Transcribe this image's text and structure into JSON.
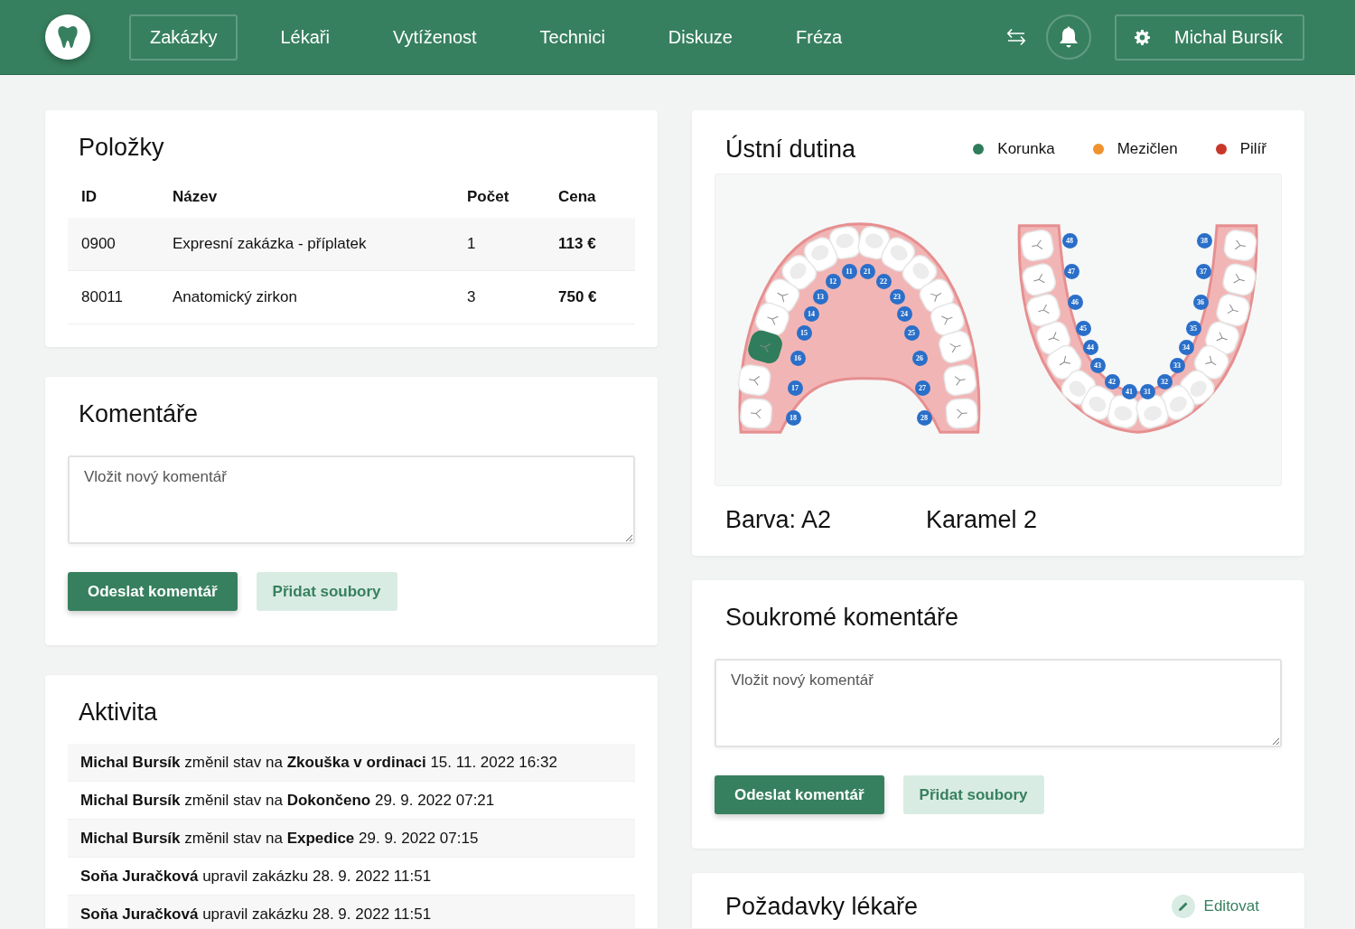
{
  "header": {
    "nav": [
      {
        "label": "Zakázky",
        "selected": true
      },
      {
        "label": "Lékaři",
        "selected": false
      },
      {
        "label": "Vytíženost",
        "selected": false
      },
      {
        "label": "Technici",
        "selected": false
      },
      {
        "label": "Diskuze",
        "selected": false
      },
      {
        "label": "Fréza",
        "selected": false
      }
    ],
    "user": {
      "name": "Michal Bursík"
    }
  },
  "items": {
    "title": "Položky",
    "columns": [
      "ID",
      "Název",
      "Počet",
      "Cena"
    ],
    "rows": [
      [
        "0900",
        "Expresní zakázka - příplatek",
        "1",
        "113 €"
      ],
      [
        "80011",
        "Anatomický zirkon",
        "3",
        "750 €"
      ]
    ]
  },
  "comments": {
    "title": "Komentáře",
    "placeholder": "Vložit nový komentář",
    "buttons": [
      {
        "label": "Odeslat komentář",
        "kind": "primary"
      },
      {
        "label": "Přidat soubory",
        "kind": "secondary"
      }
    ]
  },
  "activity": {
    "title": "Aktivita",
    "entries": [
      "**Michal Bursík** změnil stav na **Zkouška v ordinaci** 15. 11. 2022 16:32",
      "**Michal Bursík** změnil stav na **Dokončeno** 29. 9. 2022 07:21",
      "**Michal Bursík** změnil stav na **Expedice** 29. 9. 2022 07:15",
      "**Soňa Juračková** upravil zakázku 28. 9. 2022 11:51",
      "**Soňa Juračková** upravil zakázku 28. 9. 2022 11:51"
    ]
  },
  "mouth": {
    "title": "Ústní dutina",
    "legend": [
      {
        "label": "Korunka",
        "color": "#2f7d5c"
      },
      {
        "label": "Mezičlen",
        "color": "#f0922e"
      },
      {
        "label": "Pilíř",
        "color": "#c8372a"
      }
    ],
    "upper_left_teeth": [
      {
        "number": "11"
      },
      {
        "number": "12"
      },
      {
        "number": "13"
      },
      {
        "number": "14"
      },
      {
        "number": "15"
      },
      {
        "number": "16",
        "color": "#2f7d5c"
      },
      {
        "number": "17"
      },
      {
        "number": "18"
      }
    ],
    "upper_right_teeth": [
      {
        "number": "21"
      },
      {
        "number": "22"
      },
      {
        "number": "23"
      },
      {
        "number": "24"
      },
      {
        "number": "25"
      },
      {
        "number": "26"
      },
      {
        "number": "27"
      },
      {
        "number": "28"
      }
    ],
    "lower_left_teeth": [
      {
        "number": "48"
      },
      {
        "number": "47"
      },
      {
        "number": "46"
      },
      {
        "number": "45"
      },
      {
        "number": "44"
      },
      {
        "number": "43"
      },
      {
        "number": "42"
      },
      {
        "number": "41"
      }
    ],
    "lower_right_teeth": [
      {
        "number": "38"
      },
      {
        "number": "37"
      },
      {
        "number": "36"
      },
      {
        "number": "35"
      },
      {
        "number": "34"
      },
      {
        "number": "33"
      },
      {
        "number": "32"
      },
      {
        "number": "31"
      }
    ],
    "shade_label": "Barva: A2",
    "shade_name": "Karamel 2"
  },
  "private_comments": {
    "title": "Soukromé komentáře",
    "placeholder": "Vložit nový komentář",
    "buttons": [
      {
        "label": "Odeslat komentář",
        "kind": "primary"
      },
      {
        "label": "Přidat soubory",
        "kind": "secondary"
      }
    ]
  },
  "doctor_requests": {
    "title": "Požadavky lékaře",
    "action": "Editovat"
  }
}
